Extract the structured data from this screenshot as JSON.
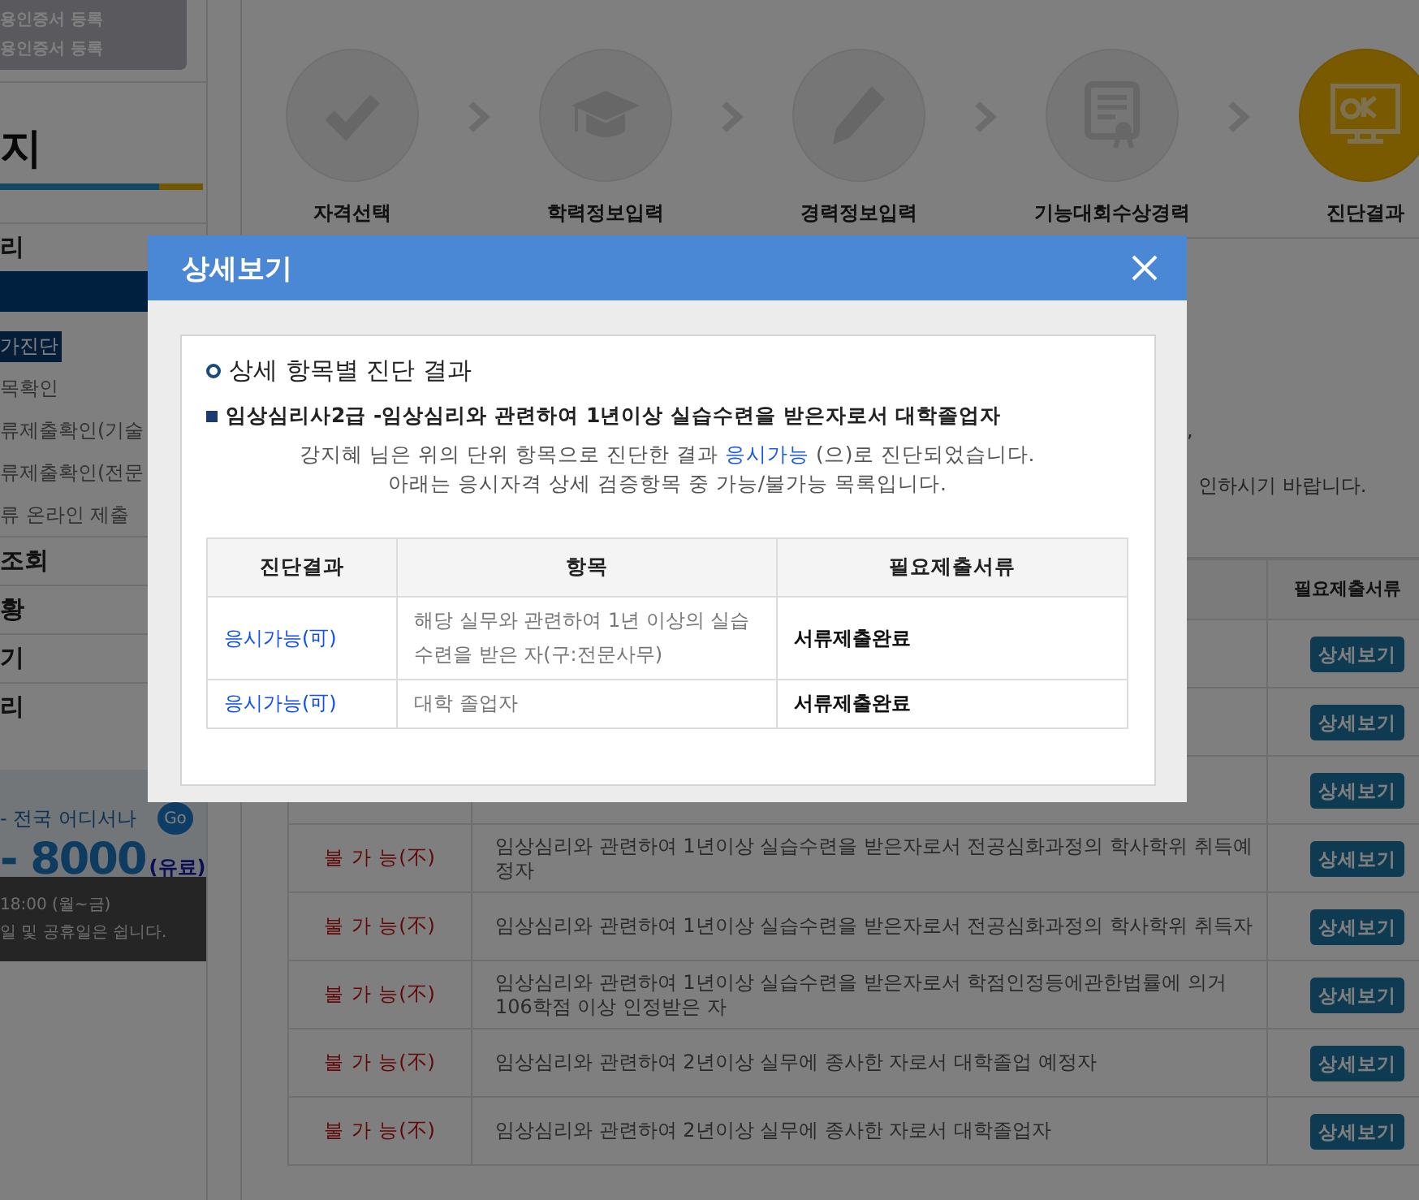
{
  "sidebar": {
    "cert_buttons": [
      "용인증서 등록",
      "용인증서 등록"
    ],
    "title": "지",
    "menu": [
      {
        "kind": "main",
        "label": "리"
      },
      {
        "kind": "open"
      },
      {
        "kind": "sub",
        "label": "가진단",
        "selected": true
      },
      {
        "kind": "sub",
        "label": "목확인",
        "selected": false
      },
      {
        "kind": "sub",
        "label": "류제출확인(기술",
        "selected": false
      },
      {
        "kind": "sub",
        "label": "류제출확인(전문",
        "selected": false
      },
      {
        "kind": "sub",
        "label": "류 온라인 제출",
        "selected": false
      },
      {
        "kind": "main",
        "label": "조회"
      },
      {
        "kind": "main",
        "label": "황"
      },
      {
        "kind": "main",
        "label": "기"
      },
      {
        "kind": "main",
        "label": "리"
      }
    ],
    "banner": {
      "tagline": "- 전국 어디서나",
      "go": "Go",
      "phone": "- 8000",
      "fee": "(유료)",
      "hours": "18:00 (월~금)",
      "closed": "일 및 공휴일은 쉽니다."
    }
  },
  "steps": [
    {
      "kind": "check",
      "label": "자격선택",
      "selected": false
    },
    {
      "kind": "cap",
      "label": "학력정보입력",
      "selected": false
    },
    {
      "kind": "pencil",
      "label": "경력정보입력",
      "selected": false
    },
    {
      "kind": "certificate",
      "label": "기능대회수상경력",
      "selected": false
    },
    {
      "kind": "monitor",
      "label": "진단결과",
      "selected": true
    }
  ],
  "notice": {
    "lines": [
      ",",
      "인하시기 바랍니다."
    ]
  },
  "table": {
    "header": "필요제출서류",
    "rows": [
      {
        "button": "상세보기"
      },
      {
        "button": "상세보기"
      },
      {
        "button": "상세보기"
      },
      {
        "kind": "fail",
        "result": "불 가 능(不)",
        "item": "임상심리와 관련하여 1년이상 실습수련을 받은자로서 전공심화과정의 학사학위 취득예정자",
        "button": "상세보기"
      },
      {
        "kind": "fail",
        "result": "불 가 능(不)",
        "item": "임상심리와 관련하여 1년이상 실습수련을 받은자로서 전공심화과정의 학사학위 취득자",
        "button": "상세보기"
      },
      {
        "kind": "fail",
        "result": "불 가 능(不)",
        "item": "임상심리와 관련하여 1년이상 실습수련을 받은자로서 학점인정등에관한법률에 의거 106학점 이상 인정받은 자",
        "button": "상세보기"
      },
      {
        "kind": "fail",
        "result": "불 가 능(不)",
        "item": "임상심리와 관련하여 2년이상 실무에 종사한 자로서 대학졸업 예정자",
        "button": "상세보기"
      },
      {
        "kind": "fail",
        "result": "불 가 능(不)",
        "item": "임상심리와 관련하여 2년이상 실무에 종사한 자로서 대학졸업자",
        "button": "상세보기"
      }
    ]
  },
  "modal": {
    "title": "상세보기",
    "section_title": "상세 항목별 진단 결과",
    "qualification": "임상심리사2급 -임상심리와 관련하여 1년이상 실습수련을 받은자로서 대학졸업자",
    "message": [
      {
        "before": "강지혜 님은 위의 단위 항목으로 진단한 결과 ",
        "highlight": "응시가능",
        "after": " (으)로 진단되었습니다."
      },
      {
        "before": "아래는 응시자격 상세 검증항목 중 가능/불가능 목록입니다."
      }
    ],
    "columns": [
      "진단결과",
      "항목",
      "필요제출서류"
    ],
    "rows": [
      {
        "kind": "pass",
        "result": "응시가능(可)",
        "item": "해당 실무와 관련하여 1년 이상의 실습수련을 받은 자(구:전문사무)",
        "documents": "서류제출완료"
      },
      {
        "kind": "pass",
        "result": "응시가능(可)",
        "item": "대학 졸업자",
        "documents": "서류제출완료"
      }
    ]
  }
}
